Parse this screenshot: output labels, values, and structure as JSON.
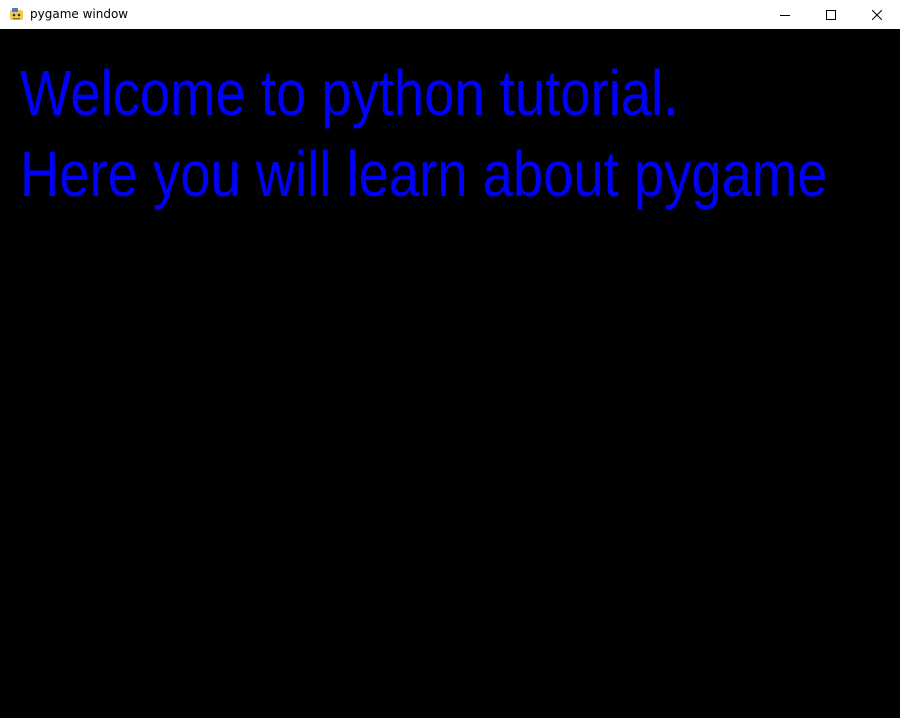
{
  "window": {
    "title": "pygame window",
    "app_icon": "pygame-snake-icon",
    "controls": {
      "minimize_icon": "minimize-icon",
      "maximize_icon": "maximize-icon",
      "close_icon": "close-icon"
    }
  },
  "game": {
    "background_color": "#000000",
    "text_color": "#0000ff",
    "lines": [
      "Welcome to python tutorial.",
      "Here you will learn about pygame"
    ]
  }
}
